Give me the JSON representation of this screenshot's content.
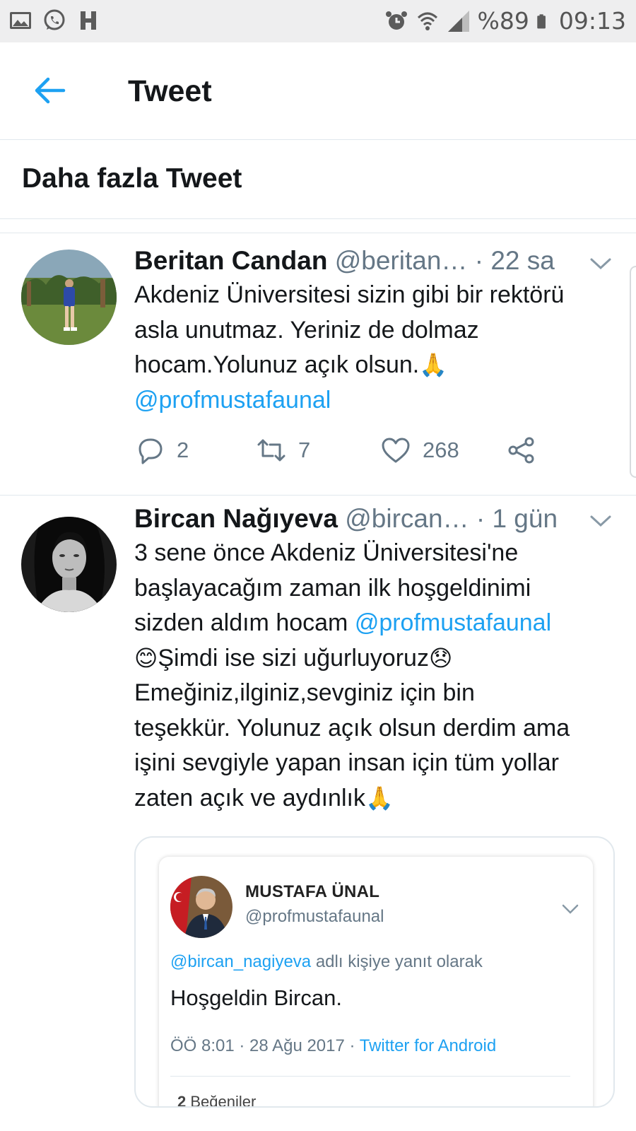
{
  "status_bar": {
    "left_icons": [
      "gallery-icon",
      "whatsapp-icon",
      "h-app-icon"
    ],
    "right_icons": [
      "alarm-icon",
      "wifi-icon",
      "signal-icon",
      "battery-icon"
    ],
    "battery": "%89",
    "time": "09:13"
  },
  "header": {
    "title": "Tweet"
  },
  "section": {
    "title": "Daha fazla Tweet"
  },
  "tweets": [
    {
      "name": "Beritan Candan",
      "handle": "@beritan…",
      "sep": "·",
      "time": "22 sa",
      "body_lines": [
        "Akdeniz Üniversitesi sizin gibi bir rektörü",
        "asla unutmaz. Yeriniz de dolmaz",
        "hocam.Yolunuz açık olsun."
      ],
      "emoji": "🙏",
      "mention": "@profmustafaunal",
      "replies": "2",
      "retweets": "7",
      "likes": "268"
    },
    {
      "name": "Bircan Nağıyeva",
      "handle": "@bircan…",
      "sep": "·",
      "time": "1 gün",
      "line1": "3 sene önce Akdeniz Üniversitesi'ne",
      "line2": "başlayacağım zaman ilk hoşgeldinimi",
      "line3_text": "sizden aldım hocam ",
      "line3_mention": "@profmustafaunal",
      "emoji_smile": "😊",
      "line4_text": "Şimdi ise sizi uğurluyoruz",
      "emoji_sad": "😞",
      "line5": "Emeğiniz,ilginiz,sevginiz için bin",
      "line6": "teşekkür. Yolunuz açık olsun derdim ama",
      "line7": "işini sevgiyle yapan insan için tüm yollar",
      "line8_text": "zaten açık ve aydınlık",
      "emoji_pray": "🙏"
    }
  ],
  "quote": {
    "name": "MUSTAFA ÜNAL",
    "handle": "@profmustafaunal",
    "reply_mention": "@bircan_nagiyeva",
    "reply_text": " adlı kişiye yanıt olarak",
    "text": "Hoşgeldin Bircan.",
    "meta_time": "ÖÖ 8:01 · 28 Ağu 2017 · ",
    "meta_source": "Twitter for Android",
    "likes_count": "2",
    "likes_label": " Beğeniler"
  },
  "colors": {
    "accent": "#1da1f2",
    "secondary_text": "#657786",
    "divider": "#e1e8ed",
    "status_bar_bg": "#eeeeef"
  }
}
